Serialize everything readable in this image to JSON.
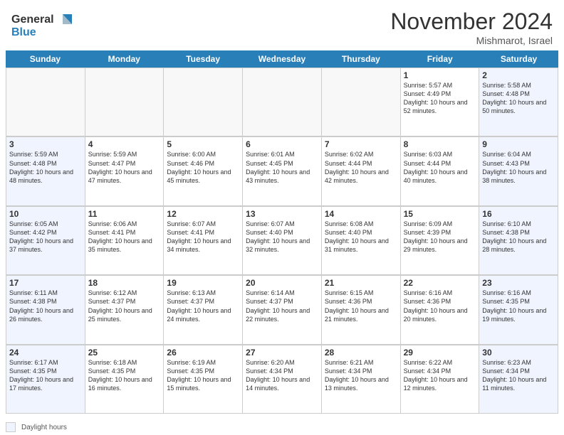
{
  "header": {
    "logo_general": "General",
    "logo_blue": "Blue",
    "month_title": "November 2024",
    "location": "Mishmarot, Israel"
  },
  "days_of_week": [
    "Sunday",
    "Monday",
    "Tuesday",
    "Wednesday",
    "Thursday",
    "Friday",
    "Saturday"
  ],
  "legend": {
    "label": "Daylight hours"
  },
  "weeks": [
    [
      {
        "day": "",
        "empty": true
      },
      {
        "day": "",
        "empty": true
      },
      {
        "day": "",
        "empty": true
      },
      {
        "day": "",
        "empty": true
      },
      {
        "day": "",
        "empty": true
      },
      {
        "day": "1",
        "sunrise": "Sunrise: 5:57 AM",
        "sunset": "Sunset: 4:49 PM",
        "daylight": "Daylight: 10 hours and 52 minutes."
      },
      {
        "day": "2",
        "sunrise": "Sunrise: 5:58 AM",
        "sunset": "Sunset: 4:48 PM",
        "daylight": "Daylight: 10 hours and 50 minutes."
      }
    ],
    [
      {
        "day": "3",
        "sunrise": "Sunrise: 5:59 AM",
        "sunset": "Sunset: 4:48 PM",
        "daylight": "Daylight: 10 hours and 48 minutes.",
        "sunday": true
      },
      {
        "day": "4",
        "sunrise": "Sunrise: 5:59 AM",
        "sunset": "Sunset: 4:47 PM",
        "daylight": "Daylight: 10 hours and 47 minutes."
      },
      {
        "day": "5",
        "sunrise": "Sunrise: 6:00 AM",
        "sunset": "Sunset: 4:46 PM",
        "daylight": "Daylight: 10 hours and 45 minutes."
      },
      {
        "day": "6",
        "sunrise": "Sunrise: 6:01 AM",
        "sunset": "Sunset: 4:45 PM",
        "daylight": "Daylight: 10 hours and 43 minutes."
      },
      {
        "day": "7",
        "sunrise": "Sunrise: 6:02 AM",
        "sunset": "Sunset: 4:44 PM",
        "daylight": "Daylight: 10 hours and 42 minutes."
      },
      {
        "day": "8",
        "sunrise": "Sunrise: 6:03 AM",
        "sunset": "Sunset: 4:44 PM",
        "daylight": "Daylight: 10 hours and 40 minutes."
      },
      {
        "day": "9",
        "sunrise": "Sunrise: 6:04 AM",
        "sunset": "Sunset: 4:43 PM",
        "daylight": "Daylight: 10 hours and 38 minutes.",
        "saturday": true
      }
    ],
    [
      {
        "day": "10",
        "sunrise": "Sunrise: 6:05 AM",
        "sunset": "Sunset: 4:42 PM",
        "daylight": "Daylight: 10 hours and 37 minutes.",
        "sunday": true
      },
      {
        "day": "11",
        "sunrise": "Sunrise: 6:06 AM",
        "sunset": "Sunset: 4:41 PM",
        "daylight": "Daylight: 10 hours and 35 minutes."
      },
      {
        "day": "12",
        "sunrise": "Sunrise: 6:07 AM",
        "sunset": "Sunset: 4:41 PM",
        "daylight": "Daylight: 10 hours and 34 minutes."
      },
      {
        "day": "13",
        "sunrise": "Sunrise: 6:07 AM",
        "sunset": "Sunset: 4:40 PM",
        "daylight": "Daylight: 10 hours and 32 minutes."
      },
      {
        "day": "14",
        "sunrise": "Sunrise: 6:08 AM",
        "sunset": "Sunset: 4:40 PM",
        "daylight": "Daylight: 10 hours and 31 minutes."
      },
      {
        "day": "15",
        "sunrise": "Sunrise: 6:09 AM",
        "sunset": "Sunset: 4:39 PM",
        "daylight": "Daylight: 10 hours and 29 minutes."
      },
      {
        "day": "16",
        "sunrise": "Sunrise: 6:10 AM",
        "sunset": "Sunset: 4:38 PM",
        "daylight": "Daylight: 10 hours and 28 minutes.",
        "saturday": true
      }
    ],
    [
      {
        "day": "17",
        "sunrise": "Sunrise: 6:11 AM",
        "sunset": "Sunset: 4:38 PM",
        "daylight": "Daylight: 10 hours and 26 minutes.",
        "sunday": true
      },
      {
        "day": "18",
        "sunrise": "Sunrise: 6:12 AM",
        "sunset": "Sunset: 4:37 PM",
        "daylight": "Daylight: 10 hours and 25 minutes."
      },
      {
        "day": "19",
        "sunrise": "Sunrise: 6:13 AM",
        "sunset": "Sunset: 4:37 PM",
        "daylight": "Daylight: 10 hours and 24 minutes."
      },
      {
        "day": "20",
        "sunrise": "Sunrise: 6:14 AM",
        "sunset": "Sunset: 4:37 PM",
        "daylight": "Daylight: 10 hours and 22 minutes."
      },
      {
        "day": "21",
        "sunrise": "Sunrise: 6:15 AM",
        "sunset": "Sunset: 4:36 PM",
        "daylight": "Daylight: 10 hours and 21 minutes."
      },
      {
        "day": "22",
        "sunrise": "Sunrise: 6:16 AM",
        "sunset": "Sunset: 4:36 PM",
        "daylight": "Daylight: 10 hours and 20 minutes."
      },
      {
        "day": "23",
        "sunrise": "Sunrise: 6:16 AM",
        "sunset": "Sunset: 4:35 PM",
        "daylight": "Daylight: 10 hours and 19 minutes.",
        "saturday": true
      }
    ],
    [
      {
        "day": "24",
        "sunrise": "Sunrise: 6:17 AM",
        "sunset": "Sunset: 4:35 PM",
        "daylight": "Daylight: 10 hours and 17 minutes.",
        "sunday": true
      },
      {
        "day": "25",
        "sunrise": "Sunrise: 6:18 AM",
        "sunset": "Sunset: 4:35 PM",
        "daylight": "Daylight: 10 hours and 16 minutes."
      },
      {
        "day": "26",
        "sunrise": "Sunrise: 6:19 AM",
        "sunset": "Sunset: 4:35 PM",
        "daylight": "Daylight: 10 hours and 15 minutes."
      },
      {
        "day": "27",
        "sunrise": "Sunrise: 6:20 AM",
        "sunset": "Sunset: 4:34 PM",
        "daylight": "Daylight: 10 hours and 14 minutes."
      },
      {
        "day": "28",
        "sunrise": "Sunrise: 6:21 AM",
        "sunset": "Sunset: 4:34 PM",
        "daylight": "Daylight: 10 hours and 13 minutes."
      },
      {
        "day": "29",
        "sunrise": "Sunrise: 6:22 AM",
        "sunset": "Sunset: 4:34 PM",
        "daylight": "Daylight: 10 hours and 12 minutes."
      },
      {
        "day": "30",
        "sunrise": "Sunrise: 6:23 AM",
        "sunset": "Sunset: 4:34 PM",
        "daylight": "Daylight: 10 hours and 11 minutes.",
        "saturday": true
      }
    ]
  ]
}
